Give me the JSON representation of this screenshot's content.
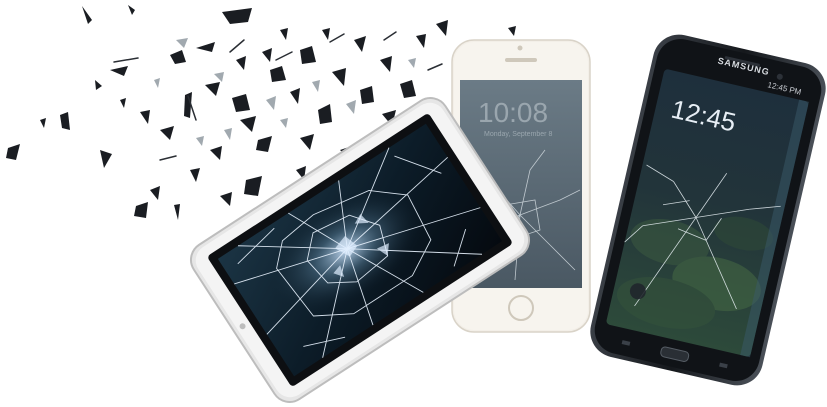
{
  "scene": {
    "background": "#ffffff",
    "devices": [
      {
        "kind": "tablet",
        "frame_color": "#f1f1f1",
        "screen_color": "#0b1a26",
        "state": "shattered"
      },
      {
        "kind": "iphone",
        "frame_color": "#f3efe8",
        "screen_color": "#5a6a78",
        "state": "cracked"
      },
      {
        "kind": "samsung-edge",
        "frame_color": "#1c1f24",
        "screen_color": "#2a3b3a",
        "state": "cracked"
      }
    ]
  },
  "iphone": {
    "clock_time": "10:08",
    "date_text": "Monday, September 8"
  },
  "samsung": {
    "brand": "SAMSUNG",
    "clock_time": "12:45",
    "status_time": "12:45 PM"
  }
}
